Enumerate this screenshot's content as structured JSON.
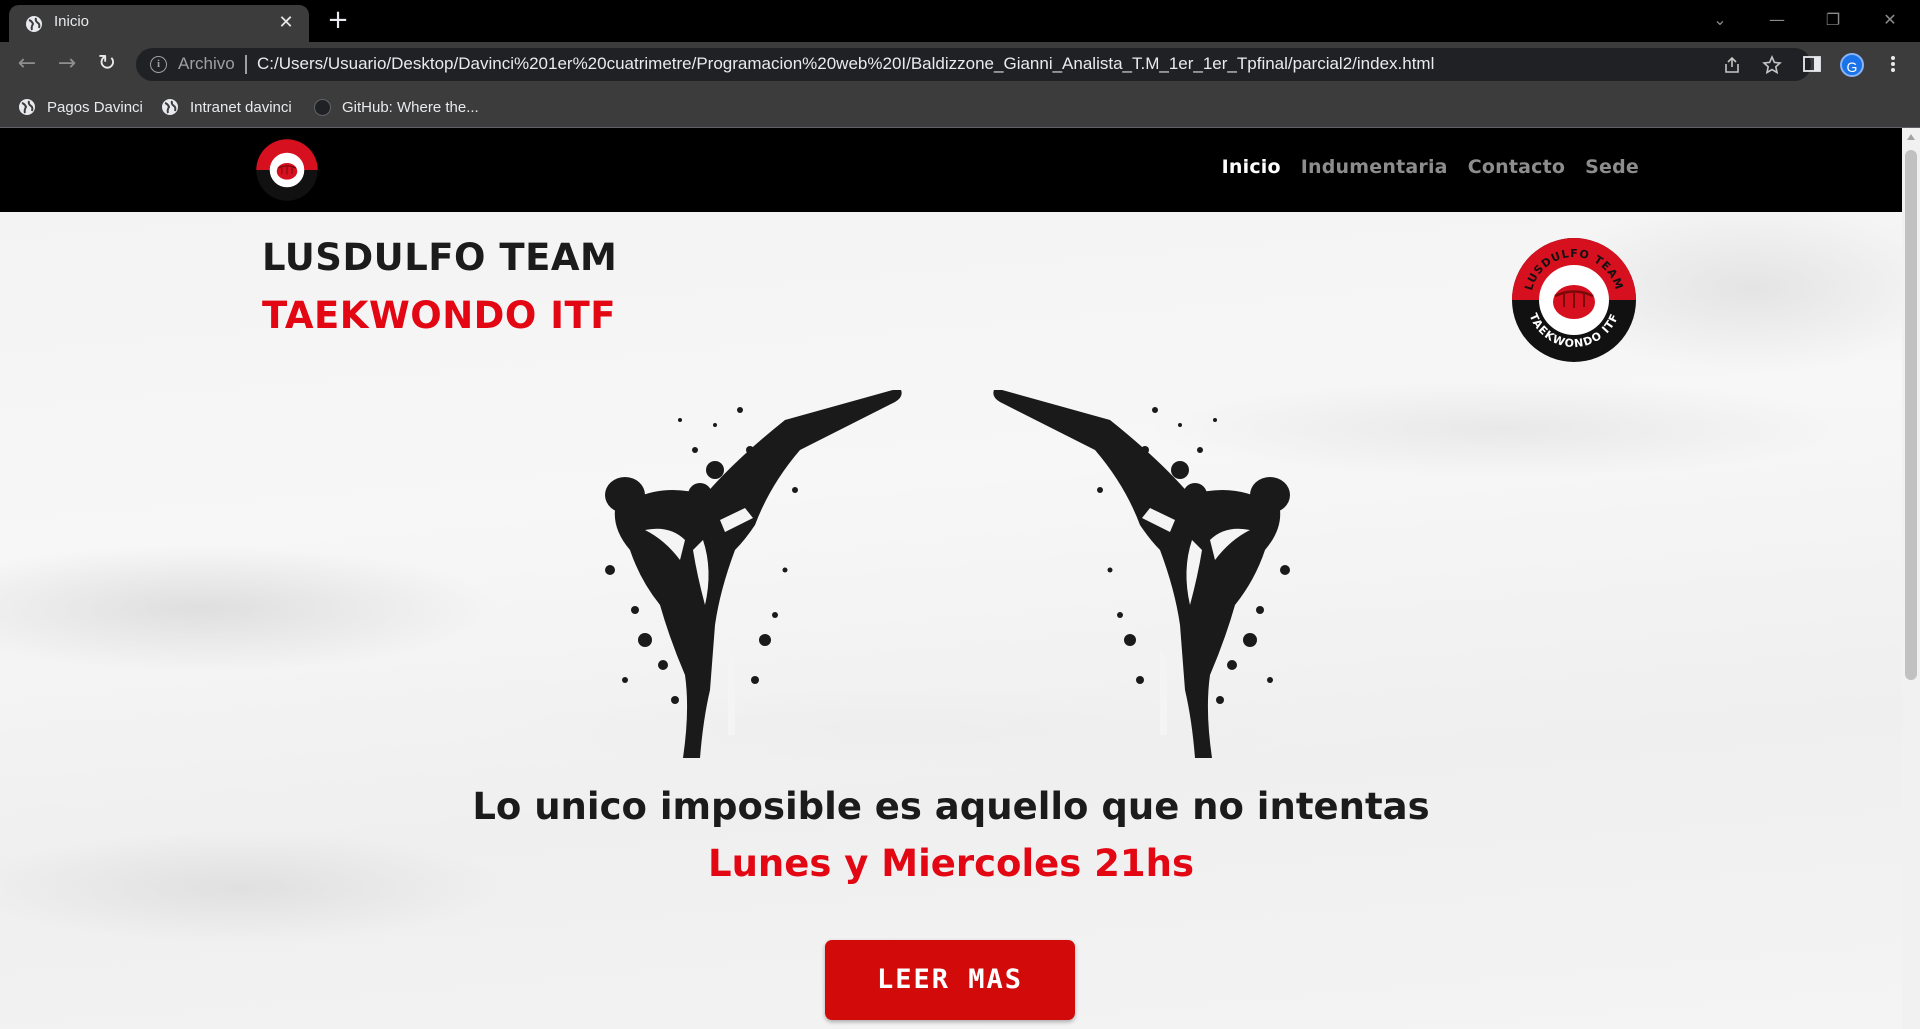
{
  "browser": {
    "tab_title": "Inicio",
    "tab_close": "✕",
    "new_tab": "+",
    "window_controls": {
      "list": "⌄",
      "minimize": "—",
      "restore": "❐",
      "close": "✕"
    },
    "nav": {
      "back": "←",
      "forward": "→",
      "reload": "↻"
    },
    "address": {
      "scheme_label": "Archivo",
      "url": "C:/Users/Usuario/Desktop/Davinci%201er%20cuatrimetre/Programacion%20web%20I/Baldizzone_Gianni_Analista_T.M_1er_1er_Tpfinal/parcial2/index.html"
    },
    "profile_initial": "G",
    "bookmarks": [
      {
        "label": "Pagos Davinci",
        "icon": "globe-icon"
      },
      {
        "label": "Intranet davinci",
        "icon": "globe-icon"
      },
      {
        "label": "GitHub: Where the...",
        "icon": "github-icon"
      }
    ]
  },
  "site": {
    "nav_links": [
      {
        "label": "Inicio",
        "active": true
      },
      {
        "label": "Indumentaria",
        "active": false
      },
      {
        "label": "Contacto",
        "active": false
      },
      {
        "label": "Sede",
        "active": false
      }
    ],
    "logo_text_top": "LUSDULFO TEAM",
    "logo_text_bottom": "TAEKWONDO ITF",
    "hero": {
      "title": "LUSDULFO TEAM",
      "subtitle": "TAEKWONDO ITF",
      "slogan": "Lo unico imposible es aquello que no intentas",
      "schedule": "Lunes y Miercoles 21hs",
      "cta_label": "LEER MAS"
    },
    "colors": {
      "accent_red": "#e30613",
      "nav_bg": "#000000",
      "button_red": "#d30a0a"
    }
  }
}
